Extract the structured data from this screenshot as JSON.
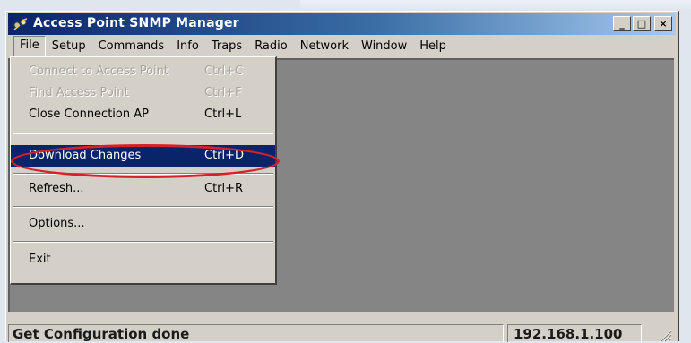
{
  "window": {
    "title": "Access Point SNMP Manager",
    "controls": {
      "minimize": "_",
      "maximize": "□",
      "close": "×"
    }
  },
  "menubar": {
    "items": [
      "File",
      "Setup",
      "Commands",
      "Info",
      "Traps",
      "Radio",
      "Network",
      "Window",
      "Help"
    ],
    "open_menu": "File"
  },
  "file_menu": {
    "items": [
      {
        "label": "Connect to Access Point",
        "shortcut": "Ctrl+C",
        "enabled": false
      },
      {
        "label": "Find Access Point",
        "shortcut": "Ctrl+F",
        "enabled": false
      },
      {
        "label": "Close Connection AP",
        "shortcut": "Ctrl+L",
        "enabled": true
      },
      {
        "label": "Download Changes",
        "shortcut": "Ctrl+D",
        "enabled": true,
        "highlighted": true
      },
      {
        "label": "Refresh...",
        "shortcut": "Ctrl+R",
        "enabled": true
      },
      {
        "label": "Options...",
        "shortcut": "",
        "enabled": true
      },
      {
        "label": "Exit",
        "shortcut": "",
        "enabled": true
      }
    ]
  },
  "statusbar": {
    "message": "Get Configuration done",
    "address": "192.168.1.100"
  },
  "colors": {
    "titlebar_start": "#0a246a",
    "titlebar_end": "#a6caf0",
    "highlight": "#0a246a",
    "annotation_ellipse": "#d8202a",
    "workspace": "#858585"
  }
}
